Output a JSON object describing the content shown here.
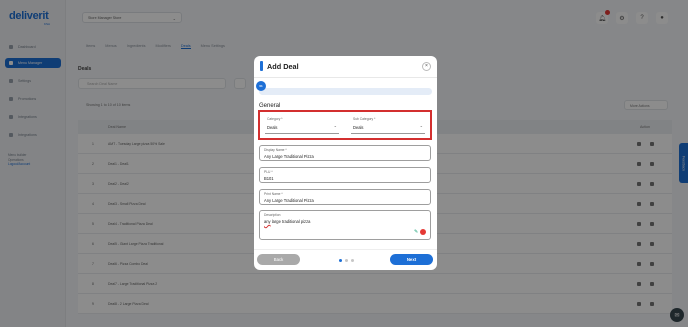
{
  "brand": {
    "name": "deliverit",
    "sub": "KSA"
  },
  "sidebar": {
    "items": [
      {
        "label": "Dashboard",
        "active": false
      },
      {
        "label": "Menu Manager",
        "active": true
      },
      {
        "label": "Settings",
        "active": false
      },
      {
        "label": "Promotions",
        "active": false
      },
      {
        "label": "Integrations",
        "active": false
      },
      {
        "label": "Integrations",
        "active": false
      }
    ],
    "user_lines": [
      "Menu builder",
      "Operations",
      "Logout/Account"
    ]
  },
  "header": {
    "store": "Store Manager Store",
    "notification_count": "3"
  },
  "tabs": [
    "Items",
    "Menus",
    "Ingredients",
    "Modifiers",
    "Deals",
    "Menu Settings"
  ],
  "main": {
    "title": "Deals",
    "search_placeholder": "Search Deal Name",
    "showing": "Showing 1 to 10 of 10 items",
    "more_actions": "More Actions"
  },
  "table": {
    "headers": [
      "Deal Name",
      "Action"
    ],
    "rows": [
      {
        "num": "1",
        "name": "AMT - Tuesday Large pizza 50% Sale"
      },
      {
        "num": "2",
        "name": "Deal1 - Deal1"
      },
      {
        "num": "3",
        "name": "Deal2 - Deal2"
      },
      {
        "num": "4",
        "name": "Deal3 - Small Pizza Deal"
      },
      {
        "num": "5",
        "name": "Deal4 - Traditional Pizza Deal"
      },
      {
        "num": "6",
        "name": "Deal5 - Giant Large Pizza Traditional"
      },
      {
        "num": "7",
        "name": "Deal6 - Pizza Combo Deal"
      },
      {
        "num": "8",
        "name": "Deal7 - Large Traditional Pizza 2"
      },
      {
        "num": "9",
        "name": "Deal8 - 2 Large Pizza Deal"
      }
    ]
  },
  "feedback_label": "Feedback",
  "modal": {
    "title": "Add Deal",
    "close_icon": "×",
    "step_badge": "01",
    "section_title": "General",
    "category": {
      "label": "Category *",
      "value": "Deals"
    },
    "sub_category": {
      "label": "Sub Category *",
      "value": "Deals"
    },
    "display_name": {
      "label": "Display Name *",
      "value": "Any Large Traditional Pizza"
    },
    "plu": {
      "label": "PLU *",
      "value": "B101"
    },
    "print_name": {
      "label": "Print Name *",
      "value": "Any Large Traditional Pizza"
    },
    "description": {
      "label": "Description",
      "value_prefix": "any",
      "value_rest": " large traditional pizza"
    },
    "back_label": "Back",
    "next_label": "Next",
    "steps": 3,
    "current_step": 1
  },
  "colors": {
    "accent": "#1d6fd6",
    "highlight": "#d32f2f",
    "back": "#a9a9a9"
  }
}
